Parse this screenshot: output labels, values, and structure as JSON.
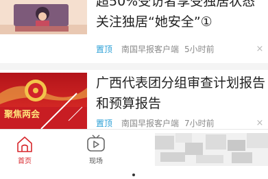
{
  "feed": [
    {
      "title_line1": "超50%受访者享受独居状态",
      "title_line2": "关注独居“她安全”①",
      "tag": "置顶",
      "source": "南国早报客户端",
      "time": "5小时前",
      "close_glyph": "×"
    },
    {
      "title_line1": "广西代表团分组审查计划报告",
      "title_line2": "和预算报告",
      "tag": "置顶",
      "source": "南国早报客户端",
      "time": "7小时前",
      "close_glyph": "×",
      "banner_text": "聚焦两会"
    }
  ],
  "tabs": [
    {
      "label": "首页",
      "icon": "home-icon",
      "active": true
    },
    {
      "label": "现场",
      "icon": "tv-play-icon",
      "active": false
    }
  ],
  "colors": {
    "accent": "#d7262b",
    "tag": "#2a9fd6",
    "text": "#222222",
    "meta": "#8a8a8a"
  }
}
